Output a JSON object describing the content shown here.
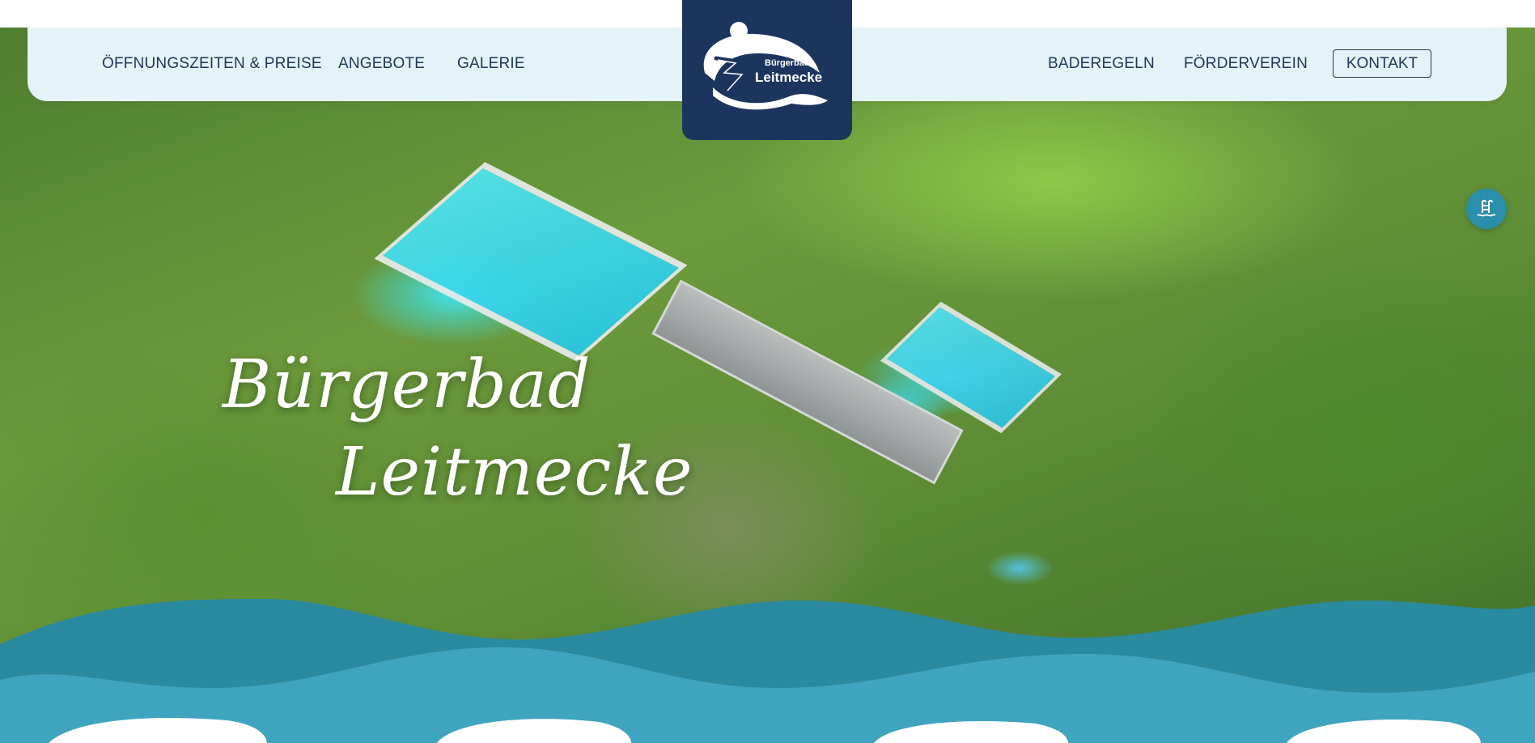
{
  "nav": {
    "left": [
      {
        "label": "ÖFFNUNGSZEITEN & PREISE"
      },
      {
        "label": "ANGEBOTE"
      },
      {
        "label": "GALERIE"
      }
    ],
    "right": [
      {
        "label": "BADEREGELN"
      },
      {
        "label": "FÖRDERVEREIN"
      }
    ],
    "contact_label": "KONTAKT"
  },
  "logo": {
    "line1": "Bürgerbad",
    "line2": "Leitmecke",
    "icon": "swimmer-logo-icon"
  },
  "hero": {
    "title_line1": "Bürgerbad",
    "title_line2": "Leitmecke",
    "image_description_icon": "aerial-pool-photo"
  },
  "side_button": {
    "icon": "pool-ladder-icon"
  },
  "colors": {
    "navy": "#1c355d",
    "nav_bg": "#e4f3f7",
    "wave_dark": "#2a8aa0",
    "wave_light": "#3fa4bd",
    "badge": "#2a8fa8"
  }
}
